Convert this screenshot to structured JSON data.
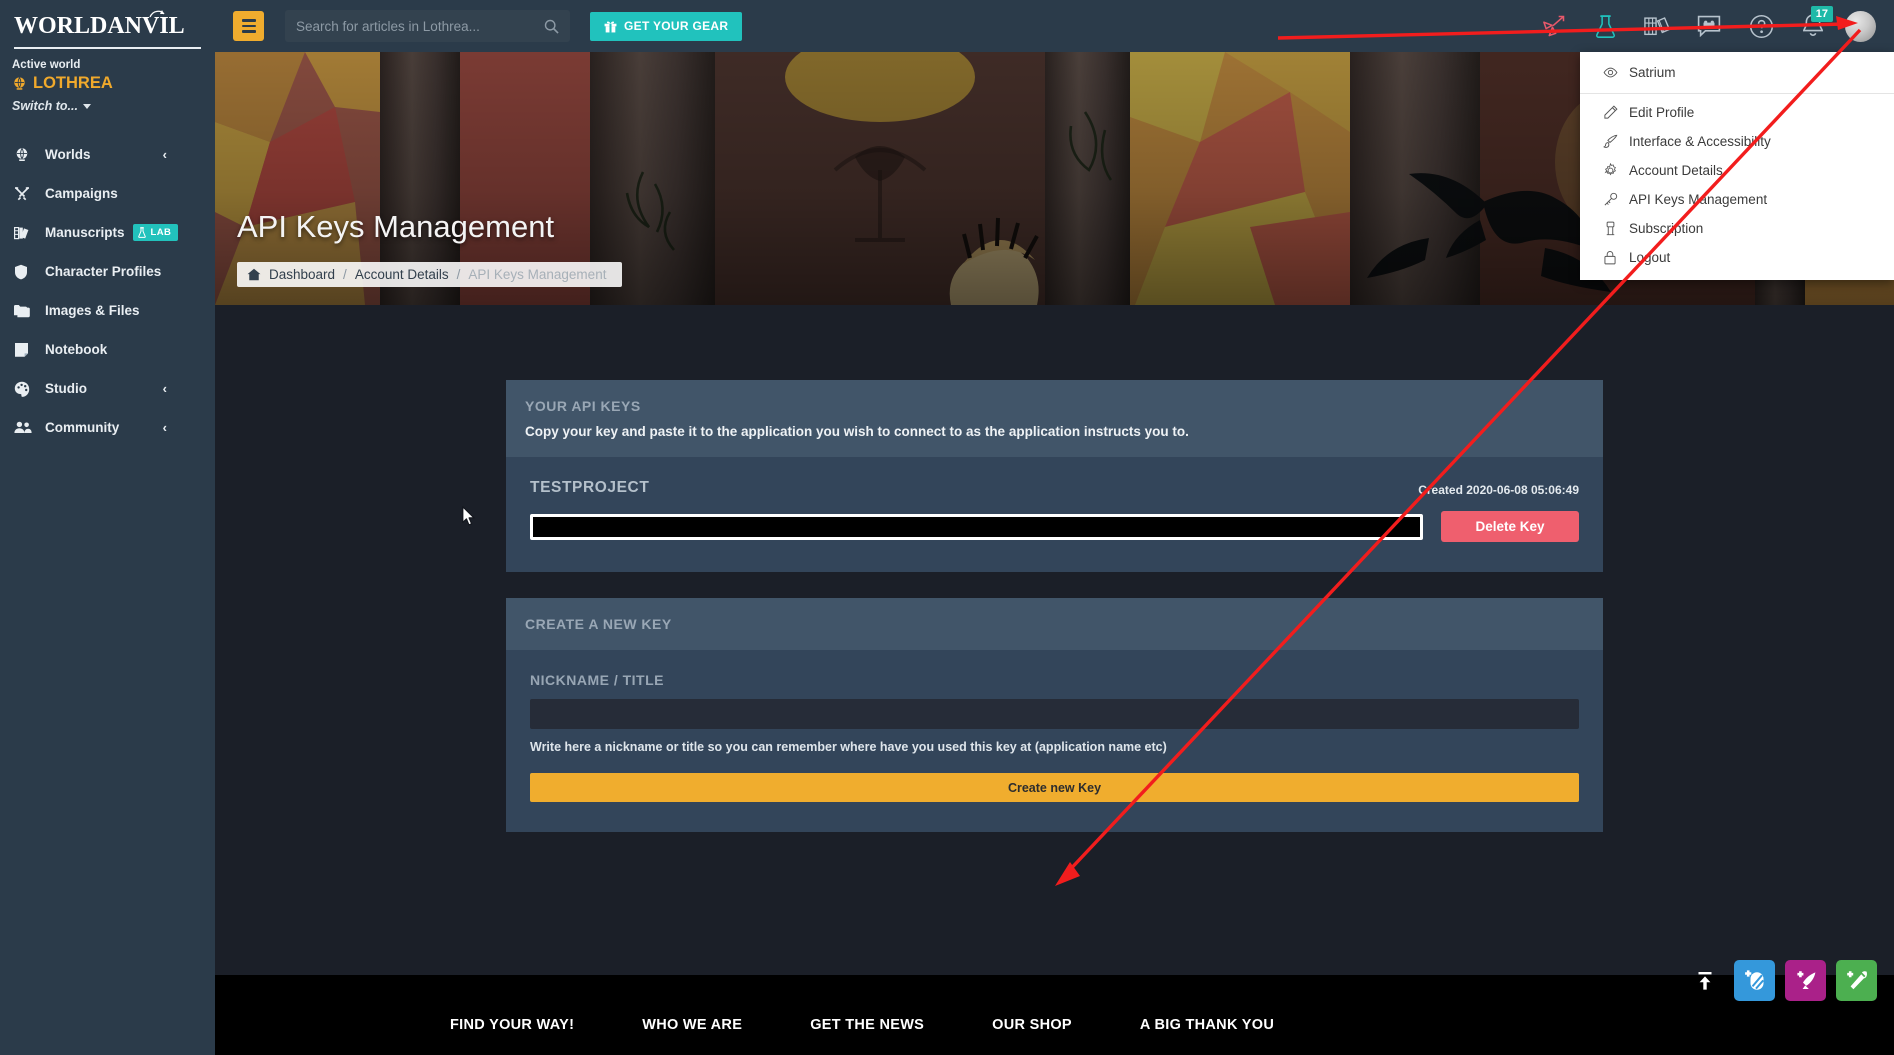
{
  "sidebar": {
    "brand": "WORLDANVIL",
    "active_world_label": "Active world",
    "active_world": "LOTHREA",
    "switch_to": "Switch to...",
    "items": [
      {
        "label": "Worlds",
        "icon": "globe-icon",
        "chevron": "‹",
        "badge": null
      },
      {
        "label": "Campaigns",
        "icon": "swords-icon",
        "chevron": null,
        "badge": null
      },
      {
        "label": "Manuscripts",
        "icon": "books-icon",
        "chevron": null,
        "badge": "LAB"
      },
      {
        "label": "Character Profiles",
        "icon": "shield-icon",
        "chevron": null,
        "badge": null
      },
      {
        "label": "Images & Files",
        "icon": "folder-icon",
        "chevron": null,
        "badge": null
      },
      {
        "label": "Notebook",
        "icon": "notebook-icon",
        "chevron": null,
        "badge": null
      },
      {
        "label": "Studio",
        "icon": "palette-icon",
        "chevron": "‹",
        "badge": null
      },
      {
        "label": "Community",
        "icon": "people-icon",
        "chevron": "‹",
        "badge": null
      }
    ]
  },
  "topbar": {
    "menu_toggle": "hamburger-icon",
    "search_placeholder": "Search for articles in Lothrea...",
    "search_value": "",
    "gear_button": "GET YOUR GEAR",
    "icons": [
      {
        "name": "rocket-icon",
        "color": "#e8596b"
      },
      {
        "name": "flask-icon",
        "color": "#20c2bd"
      },
      {
        "name": "books-icon",
        "color": "#b7c3cd"
      },
      {
        "name": "chat-icon",
        "color": "#b7c3cd"
      },
      {
        "name": "help-icon",
        "color": "#b7c3cd"
      },
      {
        "name": "bell-icon",
        "color": "#b7c3cd"
      }
    ],
    "notification_count": "17"
  },
  "user_menu": {
    "items": [
      {
        "label": "Satrium",
        "icon": "eye-icon"
      },
      {
        "label": "Edit Profile",
        "icon": "pencil-icon"
      },
      {
        "label": "Interface & Accessibility",
        "icon": "brush-icon"
      },
      {
        "label": "Account Details",
        "icon": "gear-icon"
      },
      {
        "label": "API Keys Management",
        "icon": "key-icon"
      },
      {
        "label": "Subscription",
        "icon": "card-icon"
      },
      {
        "label": "Logout",
        "icon": "lock-icon"
      }
    ]
  },
  "hero": {
    "title": "API Keys Management",
    "breadcrumb": [
      {
        "label": "Dashboard",
        "icon": "home-icon",
        "current": false
      },
      {
        "label": "Account Details",
        "icon": null,
        "current": false
      },
      {
        "label": "API Keys Management",
        "icon": null,
        "current": true
      }
    ],
    "separator": "/"
  },
  "your_keys": {
    "heading": "YOUR API KEYS",
    "description": "Copy your key and paste it to the application you wish to connect to as the application instructs you to.",
    "keys": [
      {
        "name": "TESTPROJECT",
        "created": "Created 2020-06-08 05:06:49",
        "value": "",
        "delete_label": "Delete Key"
      }
    ]
  },
  "create_key": {
    "heading": "CREATE A NEW KEY",
    "field_label": "NICKNAME / TITLE",
    "field_value": "",
    "field_placeholder": "",
    "help": "Write here a nickname or title so you can remember where have you used this key at (application name etc)",
    "submit_label": "Create new Key"
  },
  "footer": {
    "columns": [
      "FIND YOUR WAY!",
      "WHO WE ARE",
      "GET THE NEWS",
      "OUR SHOP",
      "A BIG THANK YOU"
    ]
  },
  "fabs": [
    {
      "name": "scroll-to-top-icon",
      "color": "transparent"
    },
    {
      "name": "add-image-icon",
      "color": "#3498db"
    },
    {
      "name": "add-article-icon",
      "color": "#aa2189"
    },
    {
      "name": "add-tool-icon",
      "color": "#4caf50"
    }
  ],
  "colors": {
    "sidebar": "#2b3b4a",
    "accent_yellow": "#f0ac2e",
    "accent_teal": "#21c2bd",
    "danger": "#ef5f6e",
    "panel": "#33455a",
    "panel_head": "#415569",
    "main_bg": "#1b1f28",
    "annotation": "#f21d1d"
  }
}
